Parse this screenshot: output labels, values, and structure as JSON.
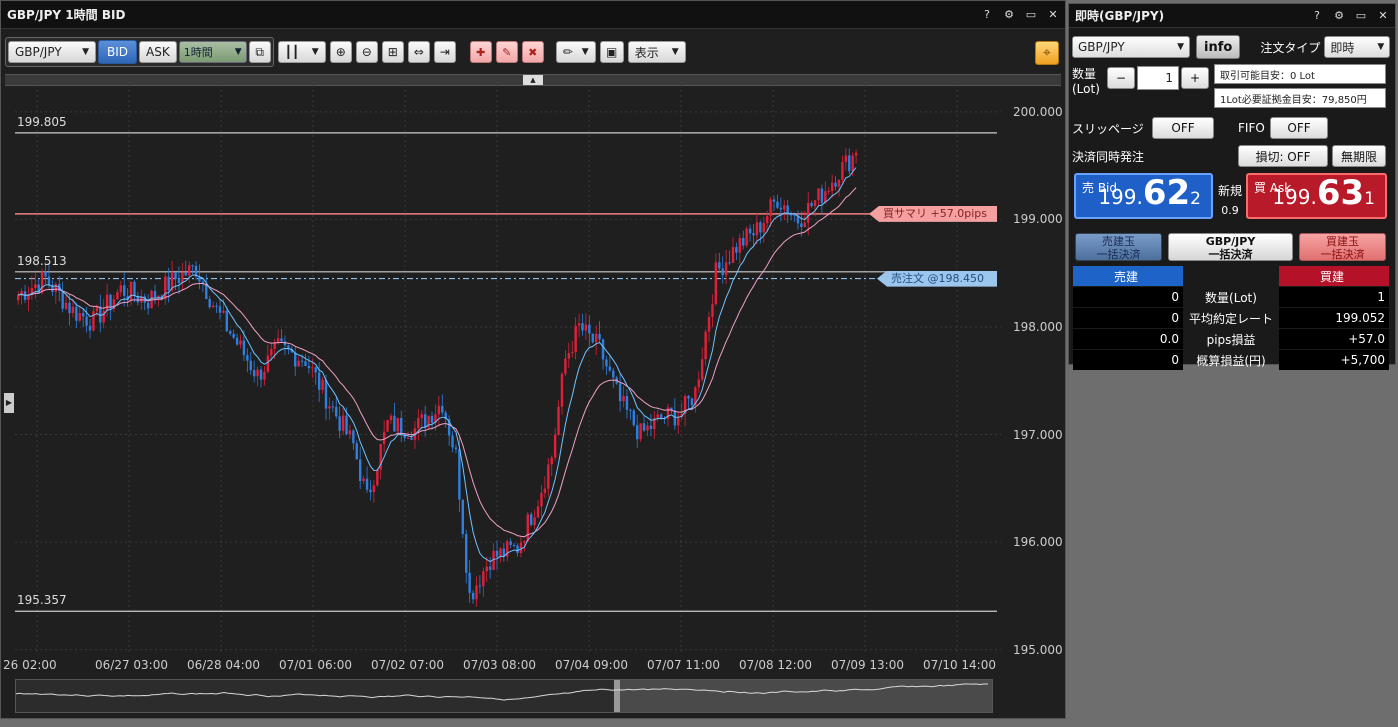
{
  "chart_window": {
    "title": "GBP/JPY 1時間 BID",
    "title_icons": [
      "?",
      "⚙",
      "▭",
      "✕"
    ],
    "toolbar": {
      "symbol": "GBP/JPY",
      "bid_label": "BID",
      "ask_label": "ASK",
      "timeframe": "1時間",
      "display_label": "表示"
    }
  },
  "chart_data": {
    "type": "candlestick",
    "title": "GBP/JPY 1時間 BID",
    "ylim": [
      194.95,
      200.25
    ],
    "yticks": [
      "200.000",
      "199.000",
      "198.000",
      "197.000",
      "196.000",
      "195.000"
    ],
    "ytick_values": [
      200.0,
      199.0,
      198.0,
      197.0,
      196.0,
      195.0
    ],
    "xticks": [
      "26 02:00",
      "06/27 03:00",
      "06/28 04:00",
      "07/01 06:00",
      "07/02 07:00",
      "07/03 08:00",
      "07/04 09:00",
      "07/07 11:00",
      "07/08 12:00",
      "07/09 13:00",
      "07/10 14:00"
    ],
    "horizontal_lines": [
      {
        "label": "199.805",
        "value": 199.805,
        "color": "#cccccc"
      },
      {
        "label": "198.513",
        "value": 198.513,
        "color": "#cccccc"
      },
      {
        "label": "195.357",
        "value": 195.357,
        "color": "#cccccc"
      }
    ],
    "position_line": {
      "label": "買サマリ +57.0pips",
      "value": 199.052,
      "color": "#f08080"
    },
    "order_line": {
      "label": "売注文 @198.450",
      "value": 198.45,
      "color": "#8ec0ee"
    },
    "colors": {
      "up": "#e0203a",
      "down": "#2f7fe0",
      "ma_fast": "#6fc3ff",
      "ma_slow": "#f0a0c8"
    },
    "series_anchors": [
      [
        0,
        198.3
      ],
      [
        8,
        198.45
      ],
      [
        16,
        198.15
      ],
      [
        22,
        198.05
      ],
      [
        30,
        198.35
      ],
      [
        38,
        198.25
      ],
      [
        46,
        198.45
      ],
      [
        52,
        198.55
      ],
      [
        58,
        198.15
      ],
      [
        64,
        197.85
      ],
      [
        70,
        197.55
      ],
      [
        76,
        197.8
      ],
      [
        84,
        197.7
      ],
      [
        90,
        197.35
      ],
      [
        98,
        196.9
      ],
      [
        102,
        196.4
      ],
      [
        108,
        197.1
      ],
      [
        116,
        197.05
      ],
      [
        124,
        197.3
      ],
      [
        128,
        196.8
      ],
      [
        132,
        195.5
      ],
      [
        138,
        195.85
      ],
      [
        146,
        195.95
      ],
      [
        152,
        196.4
      ],
      [
        156,
        196.8
      ],
      [
        160,
        197.7
      ],
      [
        164,
        198.0
      ],
      [
        170,
        197.8
      ],
      [
        176,
        197.3
      ],
      [
        182,
        197.0
      ],
      [
        188,
        197.15
      ],
      [
        194,
        197.2
      ],
      [
        198,
        197.4
      ],
      [
        204,
        198.5
      ],
      [
        210,
        198.75
      ],
      [
        216,
        198.9
      ],
      [
        222,
        199.2
      ],
      [
        228,
        199.0
      ],
      [
        234,
        199.2
      ],
      [
        240,
        199.45
      ],
      [
        245,
        199.62
      ]
    ]
  },
  "order_window": {
    "title": "即時(GBP/JPY)",
    "title_icons": [
      "?",
      "⚙",
      "▭",
      "✕"
    ],
    "symbol": "GBP/JPY",
    "info_label": "info",
    "order_type_label": "注文タイプ",
    "order_type_value": "即時",
    "qty_label": "数量",
    "qty_unit": "(Lot)",
    "qty_minus": "−",
    "qty_value": "1",
    "qty_plus": "+",
    "tradable": "取引可能目安：0 Lot",
    "margin": "1Lot必要証拠金目安：79,850円",
    "slippage_label": "スリッページ",
    "slippage_value": "OFF",
    "fifo_label": "FIFO",
    "fifo_value": "OFF",
    "settle_label": "決済同時発注",
    "stoploss_btn": "損切: OFF",
    "unlimited_btn": "無期限",
    "bid": {
      "caption": "売 Bid",
      "p1": "199.",
      "p2": "62",
      "p3": "2",
      "color": "#1f5fc8"
    },
    "ask": {
      "caption": "買 Ask",
      "p1": "199.",
      "p2": "63",
      "p3": "1",
      "color": "#b81a2a"
    },
    "spread_label": "新規",
    "spread_value": "0.9",
    "close_sell": [
      "売建玉",
      "一括決済"
    ],
    "close_all": [
      "GBP/JPY",
      "一括決済"
    ],
    "close_buy": [
      "買建玉",
      "一括決済"
    ],
    "table": {
      "sell_header": "売建",
      "buy_header": "買建",
      "rows": [
        {
          "sell": "0",
          "label": "数量(Lot)",
          "buy": "1"
        },
        {
          "sell": "0",
          "label": "平均約定レート",
          "buy": "199.052"
        },
        {
          "sell": "0.0",
          "label": "pips損益",
          "buy": "+57.0"
        },
        {
          "sell": "0",
          "label": "概算損益(円)",
          "buy": "+5,700"
        }
      ]
    }
  }
}
